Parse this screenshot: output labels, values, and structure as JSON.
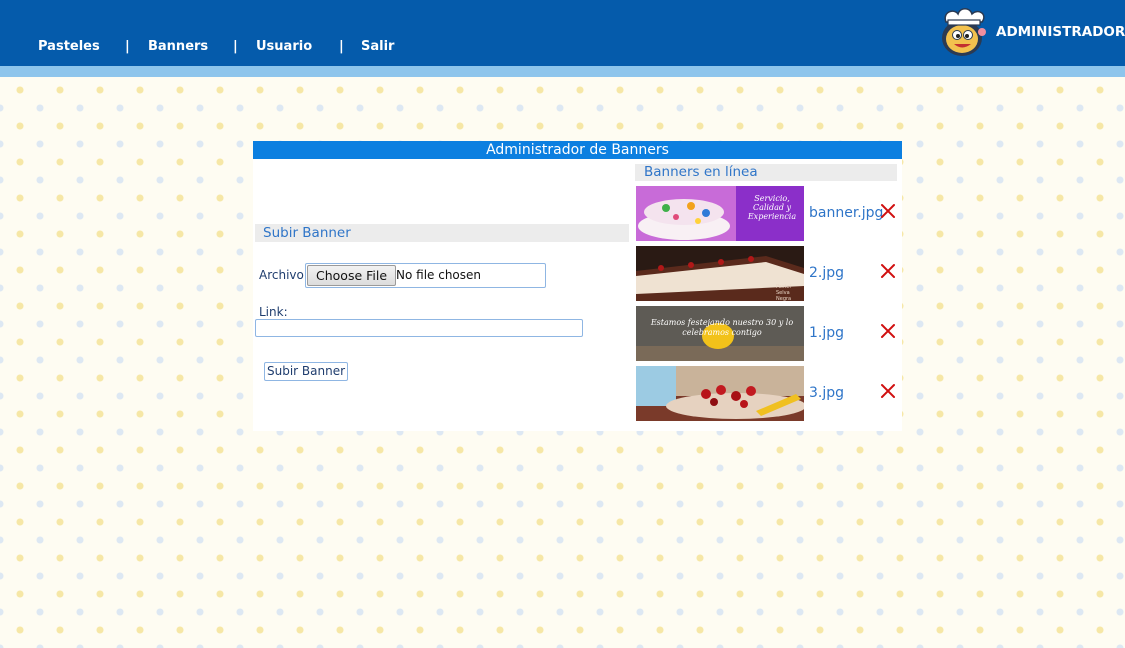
{
  "nav": {
    "items": [
      "Pasteles",
      "Banners",
      "Usuario",
      "Salir"
    ],
    "separator": "|"
  },
  "brand": {
    "label": "ADMINISTRADOR",
    "logo_icon": "chef-mascot-logo"
  },
  "panel": {
    "title": "Administrador de Banners",
    "upload": {
      "heading": "Subir Banner",
      "file_label": "Archivo:",
      "file_button": "Choose File",
      "file_status": "No file chosen",
      "link_label": "Link:",
      "link_value": "",
      "submit_label": "Subir Banner"
    },
    "online": {
      "heading": "Banners en línea",
      "banners": [
        {
          "filename": "banner.jpg",
          "thumb_text": "Servicio, Calidad y Experiencia",
          "delete_icon": "delete-x-icon"
        },
        {
          "filename": "2.jpg",
          "thumb_text": "Pastel Selva Negra",
          "delete_icon": "delete-x-icon"
        },
        {
          "filename": "1.jpg",
          "thumb_text": "Estamos festejando nuestro 30 y lo celebramos contigo",
          "delete_icon": "delete-x-icon"
        },
        {
          "filename": "3.jpg",
          "thumb_text": "",
          "delete_icon": "delete-x-icon"
        }
      ]
    }
  },
  "colors": {
    "header": "#055bab",
    "subheader": "#8ec5ec",
    "title_bar": "#0c7fe0",
    "link": "#2f75c8",
    "delete": "#d01010"
  }
}
